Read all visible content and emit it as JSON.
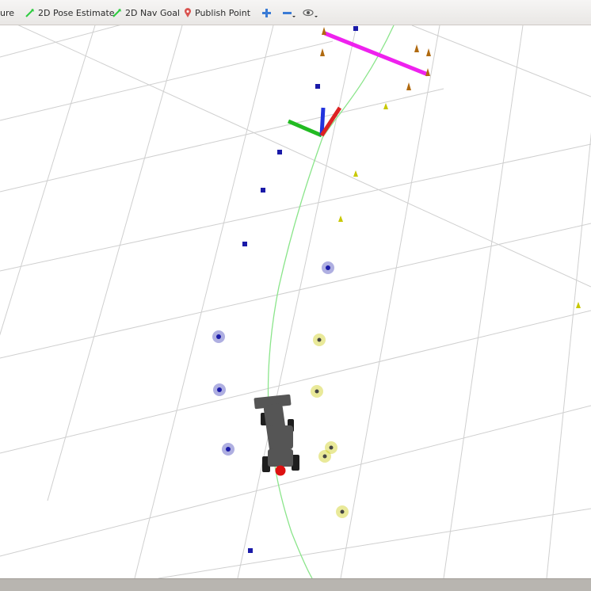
{
  "toolbar": {
    "tools": [
      {
        "id": "select",
        "label": "ure",
        "icon": "none"
      },
      {
        "id": "pose-estimate",
        "label": "2D Pose Estimate",
        "icon": "green-arrow-icon"
      },
      {
        "id": "nav-goal",
        "label": "2D Nav Goal",
        "icon": "green-arrow-icon"
      },
      {
        "id": "publish-point",
        "label": "Publish Point",
        "icon": "map-pin-icon"
      }
    ],
    "view_buttons": [
      "plus-icon",
      "minus-icon",
      "eye-icon"
    ]
  },
  "scene": {
    "colors": {
      "grid": "#cfcfcf",
      "path": "#8be58b",
      "blue_cone": "#1a1aa8",
      "yellow_cone": "#c8c800",
      "orange_cone": "#b06a10",
      "goal_line": "#ee22ee",
      "axis_x": "#dd2222",
      "axis_y": "#22bb22",
      "axis_z": "#2233dd",
      "car_body": "#555555",
      "car_nose": "#dd1111"
    }
  }
}
